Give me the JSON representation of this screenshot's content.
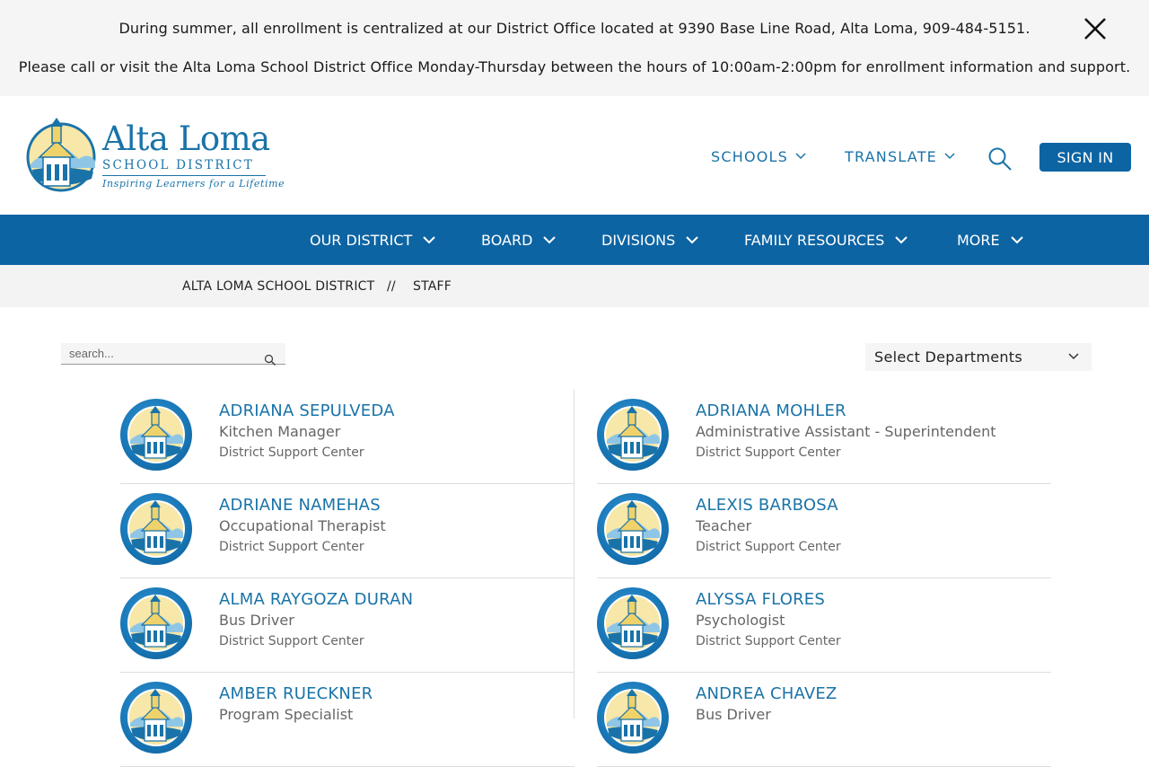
{
  "alert": {
    "line1": "During summer, all enrollment is centralized at our District Office located at 9390 Base Line Road, Alta Loma, 909-484-5151.",
    "line2": "Please call or visit the Alta Loma School District Office Monday-Thursday between the hours of 10:00am-2:00pm for enrollment information and support.",
    "close_icon": "close-icon"
  },
  "header": {
    "logo": {
      "title": "Alta Loma",
      "subtitle": "SCHOOL DISTRICT",
      "tagline": "Inspiring Learners for a Lifetime"
    },
    "schools_label": "SCHOOLS",
    "translate_label": "TRANSLATE",
    "search_icon": "search-icon",
    "signin_label": "SIGN IN"
  },
  "nav": {
    "items": [
      {
        "label": "OUR DISTRICT"
      },
      {
        "label": "BOARD"
      },
      {
        "label": "DIVISIONS"
      },
      {
        "label": "FAMILY RESOURCES"
      },
      {
        "label": "MORE"
      }
    ]
  },
  "breadcrumb": {
    "home": "ALTA LOMA SCHOOL DISTRICT",
    "separator": "//",
    "current": "STAFF"
  },
  "toolbar": {
    "search_placeholder": "search...",
    "dept_select": "Select Departments"
  },
  "staff": [
    {
      "name": "ADRIANA SEPULVEDA",
      "title": "Kitchen Manager",
      "location": "District Support Center"
    },
    {
      "name": "ADRIANA MOHLER",
      "title": "Administrative Assistant - Superintendent",
      "location": "District Support Center"
    },
    {
      "name": "ADRIANE NAMEHAS",
      "title": "Occupational Therapist",
      "location": "District Support Center"
    },
    {
      "name": "ALEXIS BARBOSA",
      "title": "Teacher",
      "location": "District Support Center"
    },
    {
      "name": "ALMA RAYGOZA DURAN",
      "title": "Bus Driver",
      "location": "District Support Center"
    },
    {
      "name": "ALYSSA FLORES",
      "title": "Psychologist",
      "location": "District Support Center"
    },
    {
      "name": "AMBER RUECKNER",
      "title": "Program Specialist",
      "location": ""
    },
    {
      "name": "ANDREA CHAVEZ",
      "title": "Bus Driver",
      "location": ""
    }
  ],
  "colors": {
    "brand_blue": "#0d64a3",
    "link_blue": "#1a73a8",
    "banner_bg": "#f5f5f5"
  }
}
